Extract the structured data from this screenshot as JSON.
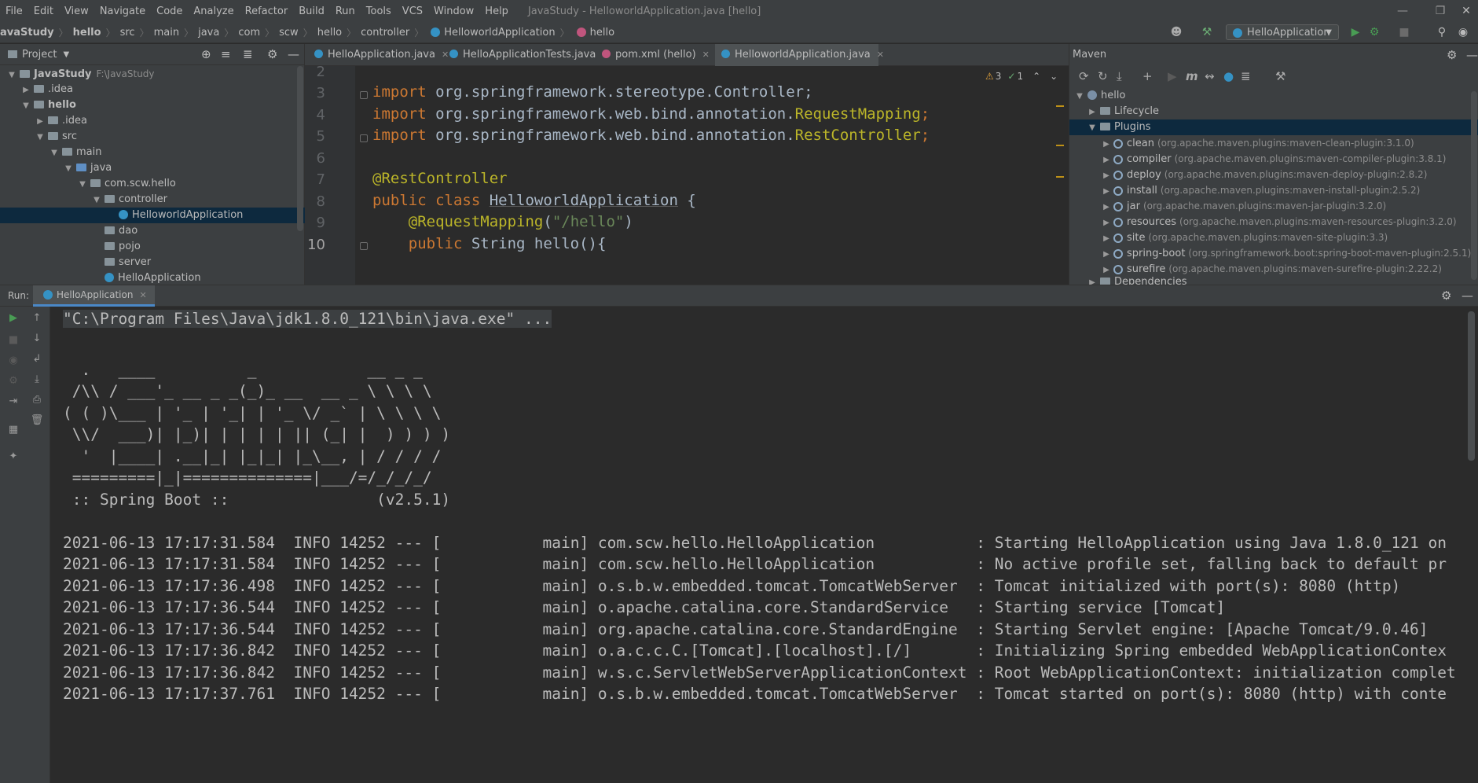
{
  "menu": {
    "items": [
      "File",
      "Edit",
      "View",
      "Navigate",
      "Code",
      "Analyze",
      "Refactor",
      "Build",
      "Run",
      "Tools",
      "VCS",
      "Window",
      "Help"
    ],
    "window_title": "JavaStudy - HelloworldApplication.java [hello]"
  },
  "breadcrumb": [
    "avaStudy",
    "hello",
    "src",
    "main",
    "java",
    "com",
    "scw",
    "hello",
    "controller",
    "HelloworldApplication",
    "hello"
  ],
  "toolbar": {
    "run_config": "HelloApplication"
  },
  "project": {
    "header": "Project",
    "tree": [
      {
        "label": "JavaStudy",
        "extra": "F:\\JavaStudy"
      },
      {
        "label": ".idea"
      },
      {
        "label": "hello"
      },
      {
        "label": ".idea"
      },
      {
        "label": "src"
      },
      {
        "label": "main"
      },
      {
        "label": "java"
      },
      {
        "label": "com.scw.hello"
      },
      {
        "label": "controller"
      },
      {
        "label": "HelloworldApplication"
      },
      {
        "label": "dao"
      },
      {
        "label": "pojo"
      },
      {
        "label": "server"
      },
      {
        "label": "HelloApplication"
      }
    ]
  },
  "editor": {
    "tabs": [
      "HelloApplication.java",
      "HelloApplicationTests.java",
      "pom.xml (hello)",
      "HelloworldApplication.java"
    ],
    "inspections": {
      "warnings": "3",
      "weak": "1"
    },
    "line_numbers": [
      "2",
      "3",
      "4",
      "5",
      "6",
      "7",
      "8",
      "9",
      "10"
    ],
    "lines": [
      {
        "parts": []
      },
      {
        "parts": [
          [
            "kw",
            "import "
          ],
          [
            "txt",
            "org.springframework.stereotype.Controller;"
          ]
        ]
      },
      {
        "parts": [
          [
            "kw",
            "import "
          ],
          [
            "txt",
            "org.springframework.web.bind.annotation."
          ],
          [
            "ann",
            "RequestMapping"
          ],
          [
            "kw",
            ";"
          ]
        ]
      },
      {
        "parts": [
          [
            "kw",
            "import "
          ],
          [
            "txt",
            "org.springframework.web.bind.annotation."
          ],
          [
            "ann",
            "RestController"
          ],
          [
            "kw",
            ";"
          ]
        ]
      },
      {
        "parts": []
      },
      {
        "parts": [
          [
            "ann",
            "@RestController"
          ]
        ]
      },
      {
        "parts": [
          [
            "kw",
            "public class "
          ],
          [
            "cls",
            "HelloworldApplication"
          ],
          [
            "txt",
            " {"
          ]
        ]
      },
      {
        "parts": [
          [
            "txt",
            "    "
          ],
          [
            "ann",
            "@RequestMapping"
          ],
          [
            "txt",
            "("
          ],
          [
            "str",
            "\"/hello\""
          ],
          [
            "txt",
            ")"
          ]
        ]
      },
      {
        "parts": [
          [
            "txt",
            "    "
          ],
          [
            "kw",
            "public "
          ],
          [
            "txt",
            "String hello(){"
          ]
        ]
      }
    ]
  },
  "maven": {
    "header": "Maven",
    "tree": [
      {
        "label": "hello",
        "extra": ""
      },
      {
        "label": "Lifecycle",
        "extra": ""
      },
      {
        "label": "Plugins",
        "extra": ""
      },
      {
        "label": "clean",
        "extra": "(org.apache.maven.plugins:maven-clean-plugin:3.1.0)"
      },
      {
        "label": "compiler",
        "extra": "(org.apache.maven.plugins:maven-compiler-plugin:3.8.1)"
      },
      {
        "label": "deploy",
        "extra": "(org.apache.maven.plugins:maven-deploy-plugin:2.8.2)"
      },
      {
        "label": "install",
        "extra": "(org.apache.maven.plugins:maven-install-plugin:2.5.2)"
      },
      {
        "label": "jar",
        "extra": "(org.apache.maven.plugins:maven-jar-plugin:3.2.0)"
      },
      {
        "label": "resources",
        "extra": "(org.apache.maven.plugins:maven-resources-plugin:3.2.0)"
      },
      {
        "label": "site",
        "extra": "(org.apache.maven.plugins:maven-site-plugin:3.3)"
      },
      {
        "label": "spring-boot",
        "extra": "(org.springframework.boot:spring-boot-maven-plugin:2.5.1)"
      },
      {
        "label": "surefire",
        "extra": "(org.apache.maven.plugins:maven-surefire-plugin:2.22.2)"
      },
      {
        "label": "Dependencies",
        "extra": ""
      }
    ]
  },
  "run": {
    "label": "Run:",
    "tab": "HelloApplication",
    "console": [
      "\"C:\\Program Files\\Java\\jdk1.8.0_121\\bin\\java.exe\" ...",
      "",
      "  .   ____          _            __ _ _",
      " /\\\\ / ___'_ __ _ _(_)_ __  __ _ \\ \\ \\ \\",
      "( ( )\\___ | '_ | '_| | '_ \\/ _` | \\ \\ \\ \\",
      " \\\\/  ___)| |_)| | | | | || (_| |  ) ) ) )",
      "  '  |____| .__|_| |_|_| |_\\__, | / / / /",
      " =========|_|==============|___/=/_/_/_/",
      " :: Spring Boot ::                (v2.5.1)",
      "",
      "2021-06-13 17:17:31.584  INFO 14252 --- [           main] com.scw.hello.HelloApplication           : Starting HelloApplication using Java 1.8.0_121 on",
      "2021-06-13 17:17:31.584  INFO 14252 --- [           main] com.scw.hello.HelloApplication           : No active profile set, falling back to default pr",
      "2021-06-13 17:17:36.498  INFO 14252 --- [           main] o.s.b.w.embedded.tomcat.TomcatWebServer  : Tomcat initialized with port(s): 8080 (http)",
      "2021-06-13 17:17:36.544  INFO 14252 --- [           main] o.apache.catalina.core.StandardService   : Starting service [Tomcat]",
      "2021-06-13 17:17:36.544  INFO 14252 --- [           main] org.apache.catalina.core.StandardEngine  : Starting Servlet engine: [Apache Tomcat/9.0.46]",
      "2021-06-13 17:17:36.842  INFO 14252 --- [           main] o.a.c.c.C.[Tomcat].[localhost].[/]       : Initializing Spring embedded WebApplicationContex",
      "2021-06-13 17:17:36.842  INFO 14252 --- [           main] w.s.c.ServletWebServerApplicationContext : Root WebApplicationContext: initialization complet",
      "2021-06-13 17:17:37.761  INFO 14252 --- [           main] o.s.b.w.embedded.tomcat.TomcatWebServer  : Tomcat started on port(s): 8080 (http) with conte"
    ]
  }
}
